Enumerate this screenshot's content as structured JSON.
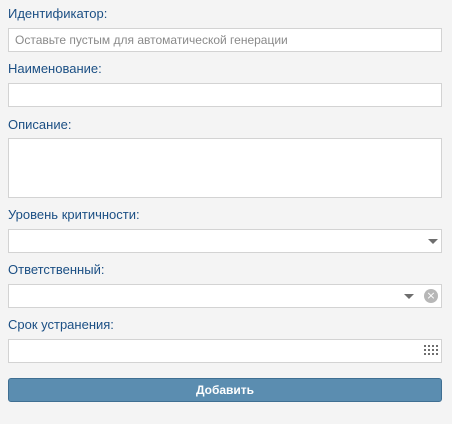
{
  "form": {
    "identifier": {
      "label": "Идентификатор:",
      "placeholder": "Оставьте пустым для автоматической генерации",
      "value": ""
    },
    "name": {
      "label": "Наименование:",
      "value": ""
    },
    "description": {
      "label": "Описание:",
      "value": ""
    },
    "criticality": {
      "label": "Уровень критичности:",
      "value": ""
    },
    "responsible": {
      "label": "Ответственный:",
      "value": ""
    },
    "deadline": {
      "label": "Срок устранения:",
      "value": ""
    },
    "submit_label": "Добавить"
  },
  "icons": {
    "criticality_dropdown": "chevron-down-icon",
    "responsible_dropdown": "chevron-down-icon",
    "responsible_clear": "clear-icon",
    "deadline_picker": "calendar-icon"
  },
  "colors": {
    "label": "#1b4f84",
    "button_bg": "#5b8db0",
    "background": "#f4f4f4"
  }
}
